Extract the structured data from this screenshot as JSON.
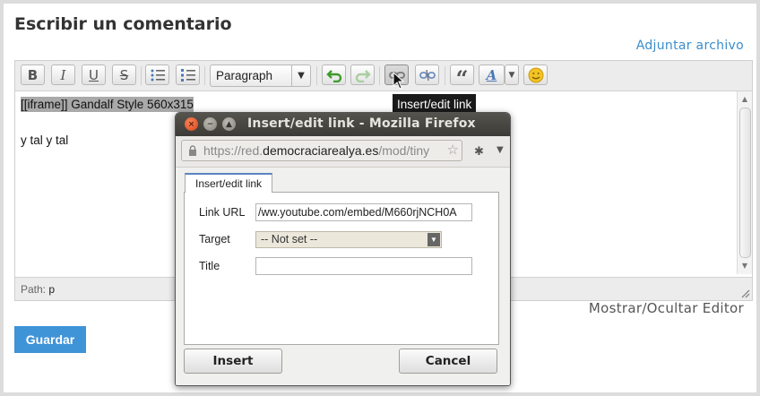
{
  "heading": "Escribir un comentario",
  "attach_link": "Adjuntar archivo",
  "toolbar": {
    "bold": "B",
    "italic": "I",
    "underline": "U",
    "strike": "S",
    "format_value": "Paragraph",
    "quote": "“",
    "font_color": "A"
  },
  "content": {
    "line1": "[[iframe]] Gandalf Style 560x315",
    "line2": "y tal y tal"
  },
  "statusbar": {
    "path_label": "Path:",
    "path_value": "p"
  },
  "toggle_editor": "Mostrar/Ocultar Editor",
  "save_button": "Guardar",
  "tooltip": "Insert/edit link",
  "popup": {
    "title": "Insert/edit link - Mozilla Firefox",
    "url_prefix": "https://red.",
    "url_domain": "democraciarealya.es",
    "url_suffix": "/mod/tiny",
    "tab": "Insert/edit link",
    "link_url_label": "Link URL",
    "link_url_value": "/ww.youtube.com/embed/M660rjNCH0A",
    "target_label": "Target",
    "target_value": "-- Not set --",
    "title_label": "Title",
    "title_value": "",
    "insert_button": "Insert",
    "cancel_button": "Cancel"
  },
  "colors": {
    "accent": "#3f93d7",
    "link": "#3b8dcc",
    "titlebar": "#3c3b37",
    "close_button": "#d9461a"
  }
}
